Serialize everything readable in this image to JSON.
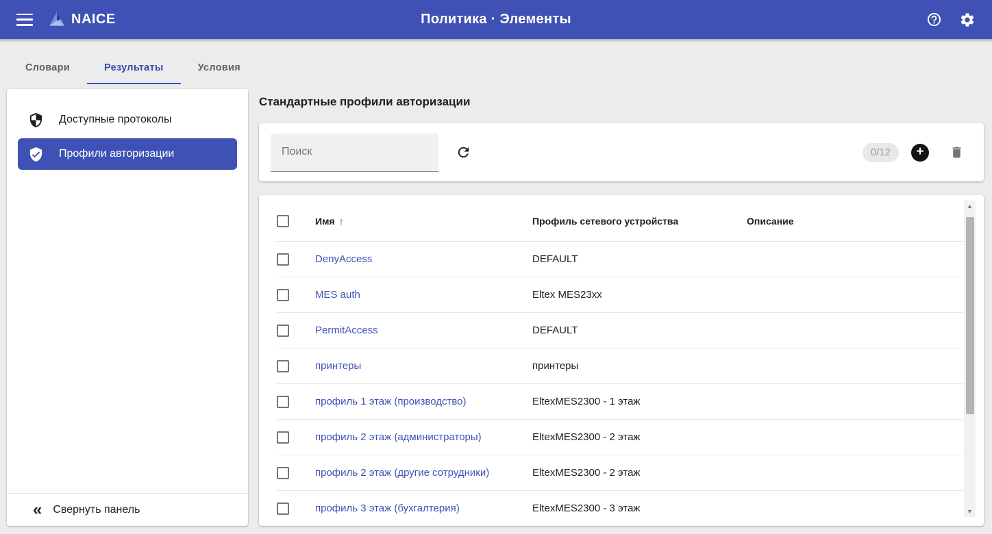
{
  "header": {
    "app_name": "NAICE",
    "title": "Политика · Элементы"
  },
  "tabs": [
    {
      "label": "Словари",
      "active": false
    },
    {
      "label": "Результаты",
      "active": true
    },
    {
      "label": "Условия",
      "active": false
    }
  ],
  "sidebar": {
    "items": [
      {
        "label": "Доступные протоколы",
        "icon": "shield-icon",
        "selected": false
      },
      {
        "label": "Профили авторизации",
        "icon": "shield-check-icon",
        "selected": true
      }
    ],
    "collapse_label": "Свернуть панель"
  },
  "main": {
    "heading": "Стандартные профили авторизации",
    "toolbar": {
      "search_placeholder": "Поиск",
      "search_value": "",
      "selection_count": "0/12"
    },
    "table": {
      "columns": {
        "name": "Имя",
        "device_profile": "Профиль сетевого устройства",
        "description": "Описание"
      },
      "sort": {
        "column": "Имя",
        "direction": "asc"
      },
      "rows": [
        {
          "name": "DenyAccess",
          "device_profile": "DEFAULT",
          "description": ""
        },
        {
          "name": "MES auth",
          "device_profile": "Eltex MES23xx",
          "description": ""
        },
        {
          "name": "PermitAccess",
          "device_profile": "DEFAULT",
          "description": ""
        },
        {
          "name": "принтеры",
          "device_profile": "принтеры",
          "description": ""
        },
        {
          "name": "профиль 1 этаж (производство)",
          "device_profile": "EltexMES2300 - 1 этаж",
          "description": ""
        },
        {
          "name": "профиль 2 этаж (администраторы)",
          "device_profile": "EltexMES2300 - 2 этаж",
          "description": ""
        },
        {
          "name": "профиль 2 этаж (другие сотрудники)",
          "device_profile": "EltexMES2300 - 2 этаж",
          "description": ""
        },
        {
          "name": "профиль 3 этаж (бухгалтерия)",
          "device_profile": "EltexMES2300 - 3 этаж",
          "description": ""
        }
      ]
    }
  },
  "icons": {
    "menu": "hamburger",
    "logo": "triangle-crystal",
    "help": "help-circle",
    "settings": "gear",
    "refresh": "refresh-arrow",
    "add": "plus-circle",
    "delete": "trash",
    "collapse": "double-chevron-left",
    "sort": "arrow-up"
  },
  "colors": {
    "accent": "#3f51b5",
    "header_bg": "#3f51b5",
    "link": "#3f51b5",
    "page_bg": "#ececec"
  }
}
